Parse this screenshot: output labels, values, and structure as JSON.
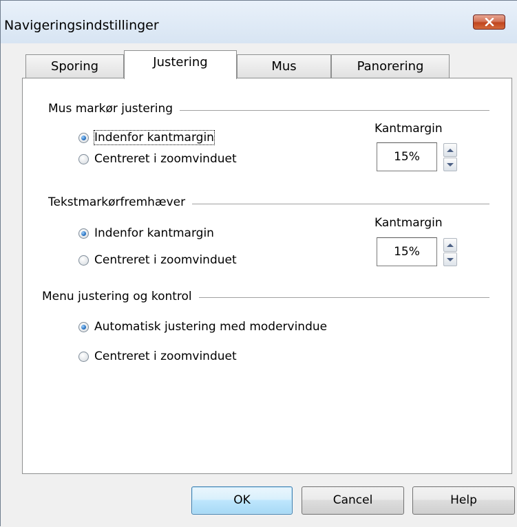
{
  "window": {
    "title": "Navigeringsindstillinger"
  },
  "tabs": [
    {
      "label": "Sporing",
      "active": false
    },
    {
      "label": "Justering",
      "active": true
    },
    {
      "label": "Mus",
      "active": false
    },
    {
      "label": "Panorering",
      "active": false
    }
  ],
  "groups": [
    {
      "title": "Mus markør justering",
      "options": [
        {
          "label": "Indenfor kantmargin",
          "checked": true
        },
        {
          "label": "Centreret i zoomvinduet",
          "checked": false
        }
      ],
      "margin_label": "Kantmargin",
      "margin_value": "15%"
    },
    {
      "title": "Tekstmarkørfremhæver",
      "options": [
        {
          "label": "Indenfor kantmargin",
          "checked": true
        },
        {
          "label": "Centreret i zoomvinduet",
          "checked": false
        }
      ],
      "margin_label": "Kantmargin",
      "margin_value": "15%"
    },
    {
      "title": "Menu justering og kontrol",
      "options": [
        {
          "label": "Automatisk justering med modervindue",
          "checked": true
        },
        {
          "label": "Centreret i zoomvinduet",
          "checked": false
        }
      ]
    }
  ],
  "buttons": {
    "ok": "OK",
    "cancel": "Cancel",
    "help": "Help"
  },
  "colors": {
    "close_button": "#c7502a",
    "default_button_border": "#3c7fb1",
    "radio_fill": "#1964b6"
  }
}
